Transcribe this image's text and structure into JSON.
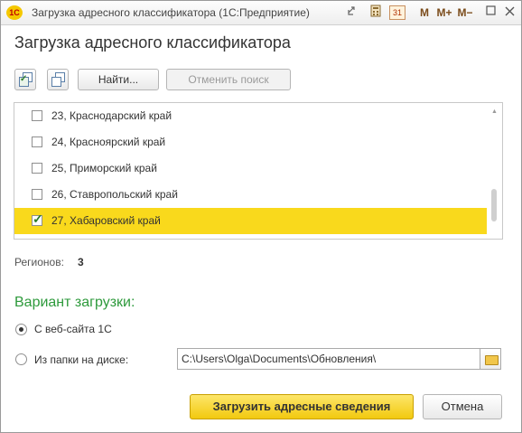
{
  "window": {
    "title": "Загрузка адресного классификатора  (1С:Предприятие)",
    "logo_text": "1C",
    "calendar_text": "31",
    "m_label": "M",
    "mplus_label": "M+",
    "mminus_label": "M−"
  },
  "form": {
    "title": "Загрузка адресного классификатора"
  },
  "toolbar": {
    "find_label": "Найти...",
    "cancel_search_label": "Отменить поиск"
  },
  "regions": [
    {
      "label": "23, Краснодарский край",
      "checked": false
    },
    {
      "label": "24, Красноярский край",
      "checked": false
    },
    {
      "label": "25, Приморский край",
      "checked": false
    },
    {
      "label": "26, Ставропольский край",
      "checked": false
    },
    {
      "label": "27, Хабаровский край",
      "checked": true,
      "selected": true
    }
  ],
  "summary": {
    "regions_label": "Регионов:",
    "regions_count": "3"
  },
  "load_variant": {
    "title": "Вариант загрузки:",
    "option_web": "С веб-сайта 1С",
    "option_folder": "Из папки на диске:",
    "selected": "web",
    "folder_path": "C:\\Users\\Olga\\Documents\\Обновления\\"
  },
  "actions": {
    "load_label": "Загрузить адресные сведения",
    "cancel_label": "Отмена"
  },
  "colors": {
    "selected_row": "#f9d91c",
    "section_title": "#2e9a3c",
    "primary_button": "#f2c90f"
  }
}
